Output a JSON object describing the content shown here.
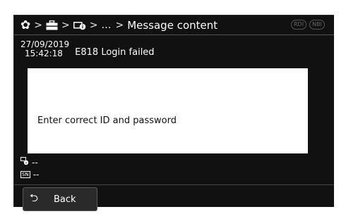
{
  "header": {
    "breadcrumb_separator": ">",
    "ellipsis": "…",
    "title": "Message content",
    "icons": [
      "gear-icon",
      "toolbox-icon",
      "device-info-icon"
    ],
    "modes": [
      "RDI",
      "NBI"
    ]
  },
  "message": {
    "date": "27/09/2019",
    "time": "15:42:18",
    "code_title": "E818 Login failed",
    "body": "Enter correct ID and password"
  },
  "info": {
    "device_value": "--",
    "sn_label": "SN",
    "sn_value": "--"
  },
  "footer": {
    "back_label": "Back",
    "back_icon": "return-arrow-icon"
  },
  "colors": {
    "background": "#111111",
    "message_box": "#ffffff",
    "text": "#ffffff"
  }
}
